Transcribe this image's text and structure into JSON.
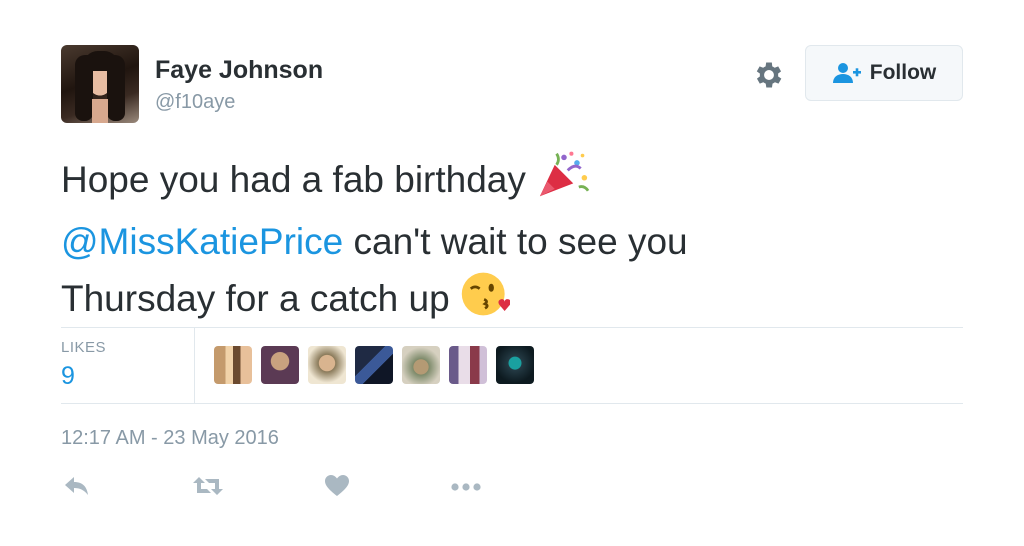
{
  "user": {
    "display_name": "Faye Johnson",
    "handle": "@f10aye"
  },
  "header": {
    "follow_label": "Follow",
    "settings_icon": "gear-icon",
    "follow_icon": "person-add-icon"
  },
  "tweet": {
    "line1_text": "Hope you had a fab birthday",
    "line1_emoji": "party-popper-emoji",
    "mention": "@MissKatiePrice",
    "line2_rest": " can't wait to see you",
    "line3_text": "Thursday for a catch up",
    "line3_emoji": "face-throwing-kiss-emoji"
  },
  "stats": {
    "likes_label": "LIKES",
    "likes_count": "9"
  },
  "likers": [
    {
      "name": "liker-avatar-1"
    },
    {
      "name": "liker-avatar-2"
    },
    {
      "name": "liker-avatar-3"
    },
    {
      "name": "liker-avatar-4"
    },
    {
      "name": "liker-avatar-5"
    },
    {
      "name": "liker-avatar-6"
    },
    {
      "name": "liker-avatar-7"
    }
  ],
  "timestamp": "12:17 AM - 23 May 2016",
  "actions": [
    {
      "name": "reply-icon"
    },
    {
      "name": "retweet-icon"
    },
    {
      "name": "like-icon"
    },
    {
      "name": "more-icon"
    }
  ],
  "colors": {
    "link_blue": "#1b95e0",
    "text_dark": "#292f33",
    "text_muted": "#8899a6",
    "icon_gray": "#aab8c2",
    "divider": "#e1e8ed"
  }
}
